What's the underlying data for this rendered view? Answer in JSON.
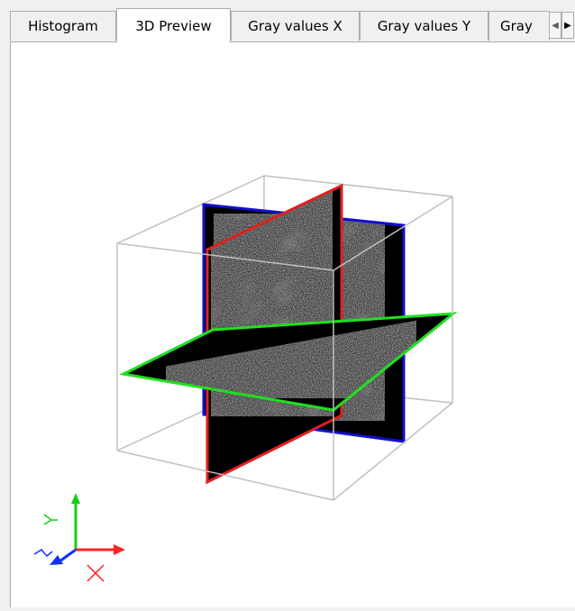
{
  "tabs": [
    {
      "label": "Histogram",
      "active": false
    },
    {
      "label": "3D Preview",
      "active": true
    },
    {
      "label": "Gray values X",
      "active": false
    },
    {
      "label": "Gray values Y",
      "active": false
    },
    {
      "label": "Gray",
      "active": false
    }
  ],
  "scroll_buttons": {
    "left_icon": "◀",
    "right_icon": "▶"
  },
  "axes": {
    "x_label": "X",
    "y_label": "Y",
    "z_label": "Z"
  },
  "colors": {
    "x_axis": "#ff2020",
    "y_axis": "#10d010",
    "z_axis": "#1030ff",
    "x_plane_border": "#e02020",
    "y_plane_border": "#20e020",
    "z_plane_border": "#1010d0",
    "bounding_box": "#c0c0c0"
  }
}
